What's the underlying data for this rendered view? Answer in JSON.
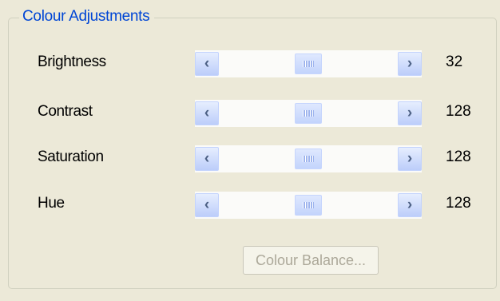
{
  "group": {
    "title": "Colour Adjustments"
  },
  "sliders": [
    {
      "label": "Brightness",
      "value": "32",
      "position": 0.5
    },
    {
      "label": "Contrast",
      "value": "128",
      "position": 0.5
    },
    {
      "label": "Saturation",
      "value": "128",
      "position": 0.5
    },
    {
      "label": "Hue",
      "value": "128",
      "position": 0.5
    }
  ],
  "buttons": {
    "colour_balance": "Colour Balance..."
  },
  "icons": {
    "left": "‹",
    "right": "›"
  },
  "colors": {
    "legend": "#0046d5",
    "disabled_text": "#aca899"
  }
}
